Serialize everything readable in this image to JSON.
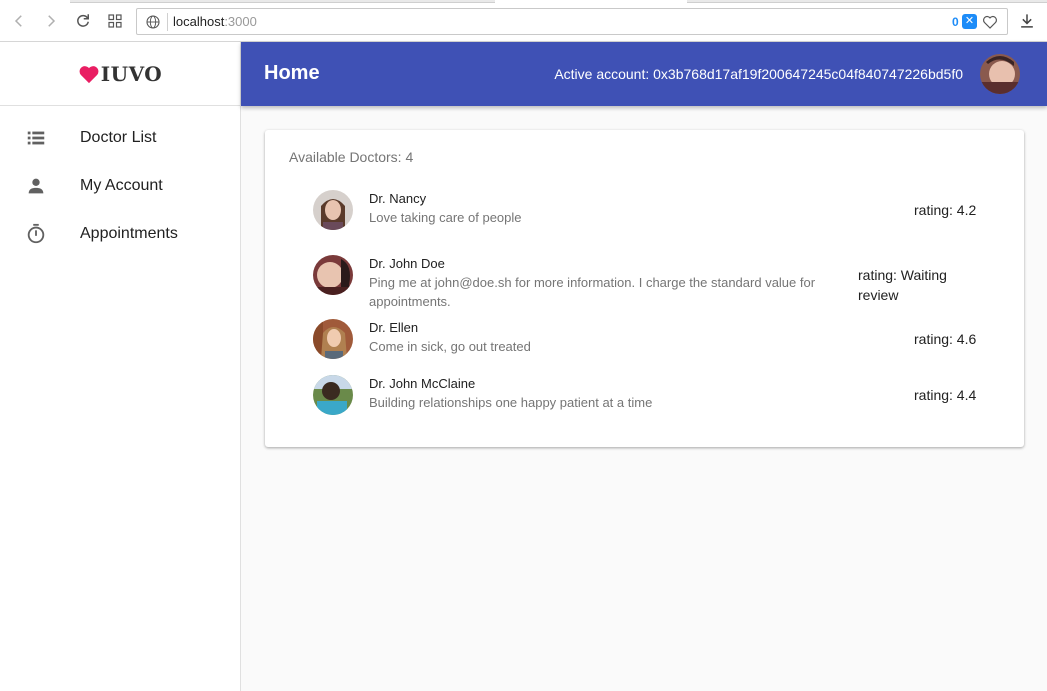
{
  "browser": {
    "url_host": "localhost",
    "url_port": ":3000",
    "extension_count": "0"
  },
  "sidebar": {
    "logo_text": "IUVO",
    "items": [
      {
        "label": "Doctor List",
        "icon": "list-icon"
      },
      {
        "label": "My Account",
        "icon": "person-icon"
      },
      {
        "label": "Appointments",
        "icon": "timer-icon"
      }
    ]
  },
  "appbar": {
    "title": "Home",
    "active_account": "Active account: 0x3b768d17af19f200647245c04f840747226bd5f0"
  },
  "card": {
    "count_text": "Available Doctors: 4",
    "doctors": [
      {
        "name": "Dr. Nancy",
        "description": "Love taking care of people",
        "rating": "rating: 4.2"
      },
      {
        "name": "Dr. John Doe",
        "description": "Ping me at john@doe.sh for more information. I charge the standard value for appointments.",
        "rating": "rating: Waiting review"
      },
      {
        "name": "Dr. Ellen",
        "description": "Come in sick, go out treated",
        "rating": "rating: 4.6"
      },
      {
        "name": "Dr. John McClaine",
        "description": "Building relationships one happy patient at a time",
        "rating": "rating: 4.4"
      }
    ]
  },
  "colors": {
    "appbar": "#3f51b5",
    "logo_heart": "#e91e63",
    "background": "#fafafa"
  }
}
